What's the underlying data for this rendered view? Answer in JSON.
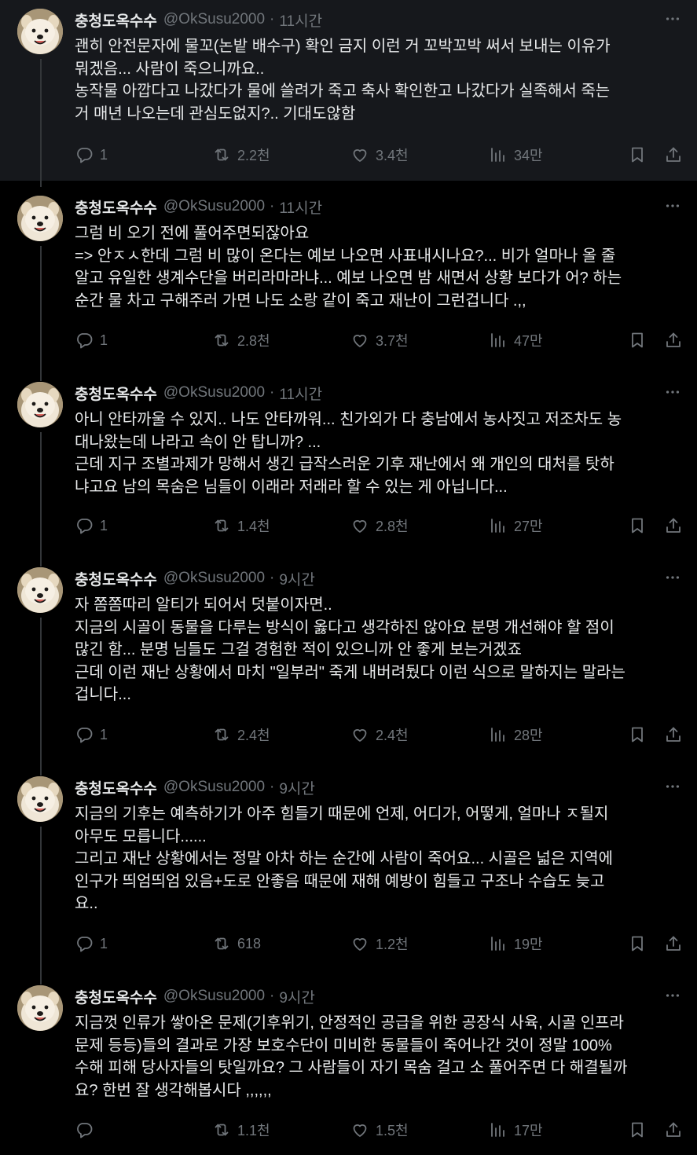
{
  "colors": {
    "background": "#000000",
    "highlight_background": "#16181c",
    "text": "#e7e9ea",
    "muted": "#71767b",
    "thread_line": "#333639"
  },
  "tweets": [
    {
      "name": "충청도옥수수",
      "handle": "@OkSusu2000",
      "time": "11시간",
      "lines": [
        "괜히 안전문자에 물꼬(논밭 배수구) 확인 금지 이런 거 꼬박꼬박 써서 보내는 이유가",
        "뭐겠음... 사람이 죽으니까요..",
        "농작물 아깝다고 나갔다가 물에 쓸려가 죽고 축사 확인한고 나갔다가 실족해서 죽는",
        "거 매년 나오는데 관심도없지?.. 기대도않함"
      ],
      "replies": "1",
      "retweets": "2.2천",
      "likes": "3.4천",
      "views": "34만"
    },
    {
      "name": "충청도옥수수",
      "handle": "@OkSusu2000",
      "time": "11시간",
      "lines": [
        "그럼 비 오기 전에 풀어주면되잖아요",
        "=> 안ㅈㅅ한데 그럼 비 많이 온다는 예보 나오면 사표내시나요?... 비가 얼마나 올 줄",
        "알고 유일한 생계수단을 버리라마라냐... 예보 나오면 밤 새면서 상황 보다가 어? 하는",
        "순간 물 차고 구해주러 가면 나도 소랑 같이 죽고 재난이 그런겁니다 .,,"
      ],
      "replies": "1",
      "retweets": "2.8천",
      "likes": "3.7천",
      "views": "47만"
    },
    {
      "name": "충청도옥수수",
      "handle": "@OkSusu2000",
      "time": "11시간",
      "lines": [
        "아니 안타까울 수 있지.. 나도 안타까워... 친가외가 다 충남에서 농사짓고 저조차도 농",
        "대나왔는데 나라고 속이 안 탑니까? ...",
        "근데 지구 조별과제가 망해서 생긴 급작스러운 기후 재난에서 왜 개인의 대처를 탓하",
        "냐고요 남의 목숨은 님들이 이래라 저래라 할 수 있는 게 아닙니다..."
      ],
      "replies": "1",
      "retweets": "1.4천",
      "likes": "2.8천",
      "views": "27만"
    },
    {
      "name": "충청도옥수수",
      "handle": "@OkSusu2000",
      "time": "9시간",
      "lines": [
        "자 쫌쫌따리 알티가 되어서 덧붙이자면..",
        "지금의 시골이 동물을 다루는 방식이 옳다고 생각하진 않아요 분명 개선해야 할 점이",
        "많긴 함... 분명 님들도 그걸 경험한 적이 있으니까 안 좋게 보는거겠죠",
        "근데 이런 재난 상황에서 마치 \"일부러\" 죽게 내버려뒀다 이런 식으로 말하지는 말라는",
        "겁니다..."
      ],
      "replies": "1",
      "retweets": "2.4천",
      "likes": "2.4천",
      "views": "28만"
    },
    {
      "name": "충청도옥수수",
      "handle": "@OkSusu2000",
      "time": "9시간",
      "lines": [
        "지금의 기후는 예측하기가 아주 힘들기 때문에 언제, 어디가, 어떻게, 얼마나 ㅈ될지",
        "아무도 모릅니다......",
        "그리고 재난 상황에서는 정말 아차 하는 순간에 사람이 죽어요... 시골은 넓은 지역에",
        "인구가 띄엄띄엄 있음+도로 안좋음 때문에 재해 예방이 힘들고 구조나 수습도 늦고",
        "요.."
      ],
      "replies": "1",
      "retweets": "618",
      "likes": "1.2천",
      "views": "19만"
    },
    {
      "name": "충청도옥수수",
      "handle": "@OkSusu2000",
      "time": "9시간",
      "lines": [
        "지금껏 인류가 쌓아온 문제(기후위기, 안정적인 공급을 위한 공장식 사육, 시골 인프라",
        "문제 등등)들의 결과로 가장 보호수단이 미비한 동물들이 죽어나간 것이 정말 100%",
        "수해 피해 당사자들의 탓일까요? 그 사람들이 자기 목숨 걸고 소 풀어주면 다 해결될까",
        "요? 한번 잘 생각해봅시다 ,,,,,,"
      ],
      "replies": "",
      "retweets": "1.1천",
      "likes": "1.5천",
      "views": "17만"
    }
  ]
}
